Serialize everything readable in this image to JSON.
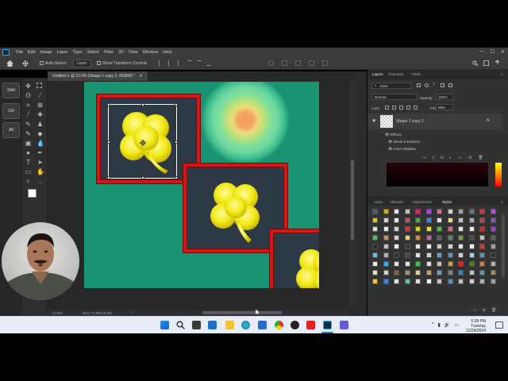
{
  "menubar": {
    "items": [
      "File",
      "Edit",
      "Image",
      "Layer",
      "Type",
      "Select",
      "Filter",
      "3D",
      "View",
      "Window",
      "Help"
    ],
    "window_controls": [
      "—",
      "☐",
      "✕"
    ]
  },
  "options_bar": {
    "auto_select": "Auto-Select:",
    "auto_select_value": "Layer",
    "show_transform": "Show Transform Controls"
  },
  "left_strip": {
    "buttons": [
      "Shift",
      "Ctrl",
      "Alt"
    ]
  },
  "document": {
    "tab_title": "Untitled-1 @ 12.6% (Shape 1 copy 3, RGB/8) *",
    "zoom": "12.6%",
    "doc_size": "Doc: 71.9M/16.5M"
  },
  "colors": {
    "canvas_bg": "#1a9373",
    "frame_red": "#d81515",
    "frame_fill": "#2d3a45",
    "clover_yellow": "#f2ea17",
    "taskbar_bg": "#e7eef7"
  },
  "panels": {
    "top_tabs": [
      "Layers",
      "Channels",
      "Paths"
    ],
    "kind_label": "Kind",
    "blend_mode": "Normal",
    "opacity_label": "Opacity:",
    "opacity_value": "100%",
    "lock_label": "Lock:",
    "fill_label": "Fill:",
    "fill_value": "89%",
    "layer_name": "Shape 1 copy 2",
    "fx_label": "fx",
    "effects": [
      "Effects",
      "Bevel & Emboss",
      "Inner Shadow"
    ],
    "bottom_tabs": [
      "Learn",
      "Libraries",
      "Adjustments",
      "Styles"
    ]
  },
  "taskbar": {
    "time": "5:28 PM",
    "day": "Tuesday",
    "date": "12/24/2024",
    "tray": [
      "^",
      "▮",
      "🔊",
      "▭"
    ]
  },
  "styles_swatches": [
    "#4a5a6a",
    "#cfae35",
    "#e0e0e0",
    "#c0c0c0",
    "#d42070",
    "#9a50d0",
    "#f06090",
    "#d0d0d0",
    "#a0a0a0",
    "#707070",
    "#e03030",
    "#b050e0",
    "#e0c020",
    "#d0d0d0",
    "#e8e8e8",
    "#e04050",
    "#50a040",
    "#4080e0",
    "#e0e0e0",
    "#f0e060",
    "#c0c0c0",
    "#a8a8a8",
    "#e83030",
    "#8a50c0",
    "#e0e0e0",
    "#e8e8e8",
    "#d0d0d0",
    "#e03030",
    "#d0d020",
    "#e0e050",
    "#4ac040",
    "#f06080",
    "#e0e0e0",
    "#e8e8e8",
    "#e02020",
    "#a040d0",
    "#50c050",
    "#d09050",
    "#d0d0d0",
    "#f0d060",
    "#e08030",
    "#c060b0",
    "#606060",
    "#509050",
    "#70a040",
    "#4a4a4a",
    "#c0c0c0",
    "#606060",
    "#282828",
    "#c0c0c0",
    "#f0f0f0",
    "#383838",
    "#e0e0e0",
    "#e8e8e8",
    "#c8c8c8",
    "#d0d0d0",
    "#e0e0e0",
    "#f4f4f4",
    "#e03030",
    "#a0a0a0",
    "#60c0f0",
    "#b0b0b0",
    "#303030",
    "#4a4a4a",
    "#e0e0e0",
    "#d0d0d0",
    "#40b0e0",
    "#5090e0",
    "#d0d0d0",
    "#a0d0f0",
    "#5a90c0",
    "#303030",
    "#e8e8e8",
    "#38a8e0",
    "#e0e0e0",
    "#e0e0e0",
    "#40c040",
    "#e0e0e0",
    "#c0c0c0",
    "#d0a020",
    "#e02020",
    "#4a8020",
    "#d08030",
    "#b0b0b0",
    "#e8e0c0",
    "#d0d0d0",
    "#8a6040",
    "#a09080",
    "#e0d080",
    "#c0a060",
    "#60a0c0",
    "#808080",
    "#4080c0",
    "#c0c0c0",
    "#40a0c0",
    "#c08040",
    "#f0c040",
    "#4080e0",
    "#e0e0e0",
    "#60c0a0",
    "#e0e0e0",
    "#f0f0f0",
    "#c0c0c0",
    "#5090d0",
    "#c0c0c0",
    "#d0d0d0",
    "#b0b0b0",
    "#a0a0a0"
  ]
}
